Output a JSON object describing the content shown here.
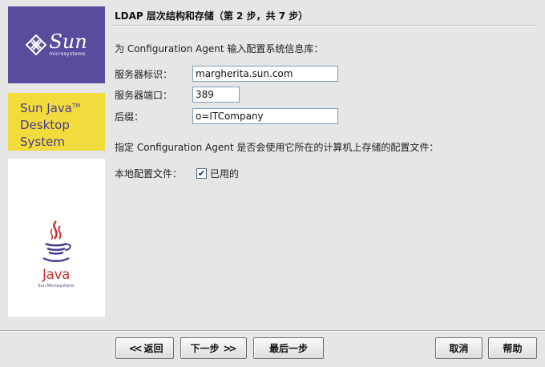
{
  "branding": {
    "sun_logo_text": "Sun",
    "sun_logo_subtext": "microsystems",
    "product_line1": "Sun Java",
    "product_tm": "TM",
    "product_line2": "Desktop",
    "product_line3": "System",
    "java_logo_text": "Java",
    "java_logo_subtext": "Sun Microsystems"
  },
  "header": {
    "title": "LDAP 层次结构和存储（第 2 步，共 7 步）"
  },
  "main": {
    "intro": "为 Configuration Agent 输入配置系统信息库：",
    "server_id_label": "服务器标识：",
    "server_id_value": "margherita.sun.com",
    "server_port_label": "服务器端口：",
    "server_port_value": "389",
    "suffix_label": "后缀：",
    "suffix_value": "o=ITCompany",
    "local_profile_intro": "指定 Configuration Agent 是否会使用它所在的计算机上存储的配置文件：",
    "local_profile_label": "本地配置文件：",
    "enabled_label": "已用的",
    "enabled_checked": true
  },
  "buttons": {
    "back": "返回",
    "next": "下一步",
    "last": "最后一步",
    "cancel": "取消",
    "help": "帮助"
  },
  "colors": {
    "sun_purple": "#5b4b9f",
    "brand_yellow": "#f2db3c",
    "java_red": "#c8312e"
  }
}
